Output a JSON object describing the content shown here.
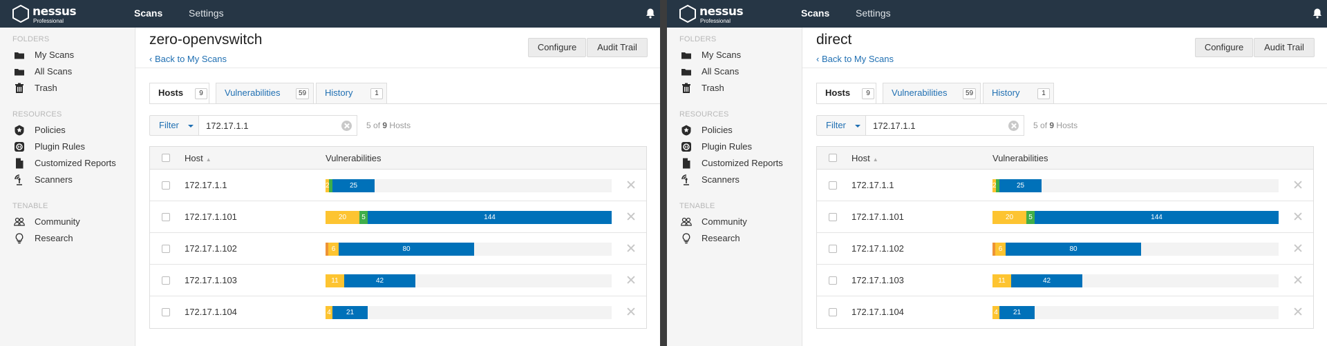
{
  "colors": {
    "topbar": "#263645",
    "link": "#1f6fb2",
    "critical": "#d43f3a",
    "high": "#ee9336",
    "medium": "#fdc431",
    "low": "#3fae49",
    "info": "#0071b9"
  },
  "screens": [
    {
      "brand": {
        "name": "nessus",
        "edition": "Professional"
      },
      "nav": {
        "scans": "Scans",
        "settings": "Settings"
      },
      "sidebar": {
        "folders_title": "FOLDERS",
        "folders": [
          {
            "label": "My Scans",
            "icon": "folder-icon"
          },
          {
            "label": "All Scans",
            "icon": "folder-icon"
          },
          {
            "label": "Trash",
            "icon": "trash-icon"
          }
        ],
        "resources_title": "RESOURCES",
        "resources": [
          {
            "label": "Policies",
            "icon": "shield-icon"
          },
          {
            "label": "Plugin Rules",
            "icon": "plugin-icon"
          },
          {
            "label": "Customized Reports",
            "icon": "document-icon"
          },
          {
            "label": "Scanners",
            "icon": "radar-icon"
          }
        ],
        "tenable_title": "TENABLE",
        "tenable": [
          {
            "label": "Community",
            "icon": "community-icon"
          },
          {
            "label": "Research",
            "icon": "lightbulb-icon"
          }
        ]
      },
      "page": {
        "title": "zero-openvswitch",
        "back": "‹ Back to My Scans",
        "configure": "Configure",
        "audit_trail": "Audit Trail"
      },
      "tabs": [
        {
          "label": "Hosts",
          "count": "9"
        },
        {
          "label": "Vulnerabilities",
          "count": "59"
        },
        {
          "label": "History",
          "count": "1"
        }
      ],
      "filter": {
        "button": "Filter",
        "value": "172.17.1.1",
        "count": "5",
        "of": "of",
        "total": "9",
        "unit": "Hosts"
      },
      "table": {
        "col_host": "Host",
        "col_vulns": "Vulnerabilities",
        "rows": [
          {
            "host": "172.17.1.1",
            "critical": 0,
            "high": 0,
            "medium": 2,
            "low": 2,
            "info": 25,
            "labels": {
              "medium": "2",
              "low": "",
              "info": "25"
            }
          },
          {
            "host": "172.17.1.101",
            "critical": 0,
            "high": 0,
            "medium": 20,
            "low": 5,
            "info": 144,
            "labels": {
              "medium": "20",
              "low": "5",
              "info": "144"
            }
          },
          {
            "host": "172.17.1.102",
            "critical": 0,
            "high": 1,
            "medium": 6,
            "low": 0,
            "info": 80,
            "labels": {
              "high": "",
              "medium": "6",
              "info": "80"
            }
          },
          {
            "host": "172.17.1.103",
            "critical": 0,
            "high": 0,
            "medium": 11,
            "low": 0,
            "info": 42,
            "labels": {
              "medium": "11",
              "info": "42"
            }
          },
          {
            "host": "172.17.1.104",
            "critical": 0,
            "high": 0,
            "medium": 4,
            "low": 0,
            "info": 21,
            "labels": {
              "medium": "4",
              "info": "21"
            }
          }
        ]
      }
    },
    {
      "brand": {
        "name": "nessus",
        "edition": "Professional"
      },
      "nav": {
        "scans": "Scans",
        "settings": "Settings"
      },
      "sidebar": {
        "folders_title": "FOLDERS",
        "folders": [
          {
            "label": "My Scans",
            "icon": "folder-icon"
          },
          {
            "label": "All Scans",
            "icon": "folder-icon"
          },
          {
            "label": "Trash",
            "icon": "trash-icon"
          }
        ],
        "resources_title": "RESOURCES",
        "resources": [
          {
            "label": "Policies",
            "icon": "shield-icon"
          },
          {
            "label": "Plugin Rules",
            "icon": "plugin-icon"
          },
          {
            "label": "Customized Reports",
            "icon": "document-icon"
          },
          {
            "label": "Scanners",
            "icon": "radar-icon"
          }
        ],
        "tenable_title": "TENABLE",
        "tenable": [
          {
            "label": "Community",
            "icon": "community-icon"
          },
          {
            "label": "Research",
            "icon": "lightbulb-icon"
          }
        ]
      },
      "page": {
        "title": "direct",
        "back": "‹ Back to My Scans",
        "configure": "Configure",
        "audit_trail": "Audit Trail"
      },
      "tabs": [
        {
          "label": "Hosts",
          "count": "9"
        },
        {
          "label": "Vulnerabilities",
          "count": "59"
        },
        {
          "label": "History",
          "count": "1"
        }
      ],
      "filter": {
        "button": "Filter",
        "value": "172.17.1.1",
        "count": "5",
        "of": "of",
        "total": "9",
        "unit": "Hosts"
      },
      "table": {
        "col_host": "Host",
        "col_vulns": "Vulnerabilities",
        "rows": [
          {
            "host": "172.17.1.1",
            "critical": 0,
            "high": 0,
            "medium": 2,
            "low": 2,
            "info": 25,
            "labels": {
              "medium": "2",
              "low": "",
              "info": "25"
            }
          },
          {
            "host": "172.17.1.101",
            "critical": 0,
            "high": 0,
            "medium": 20,
            "low": 5,
            "info": 144,
            "labels": {
              "medium": "20",
              "low": "5",
              "info": "144"
            }
          },
          {
            "host": "172.17.1.102",
            "critical": 0,
            "high": 1,
            "medium": 6,
            "low": 0,
            "info": 80,
            "labels": {
              "high": "",
              "medium": "6",
              "info": "80"
            }
          },
          {
            "host": "172.17.1.103",
            "critical": 0,
            "high": 0,
            "medium": 11,
            "low": 0,
            "info": 42,
            "labels": {
              "medium": "11",
              "info": "42"
            }
          },
          {
            "host": "172.17.1.104",
            "critical": 0,
            "high": 0,
            "medium": 4,
            "low": 0,
            "info": 21,
            "labels": {
              "medium": "4",
              "info": "21"
            }
          }
        ]
      }
    }
  ]
}
